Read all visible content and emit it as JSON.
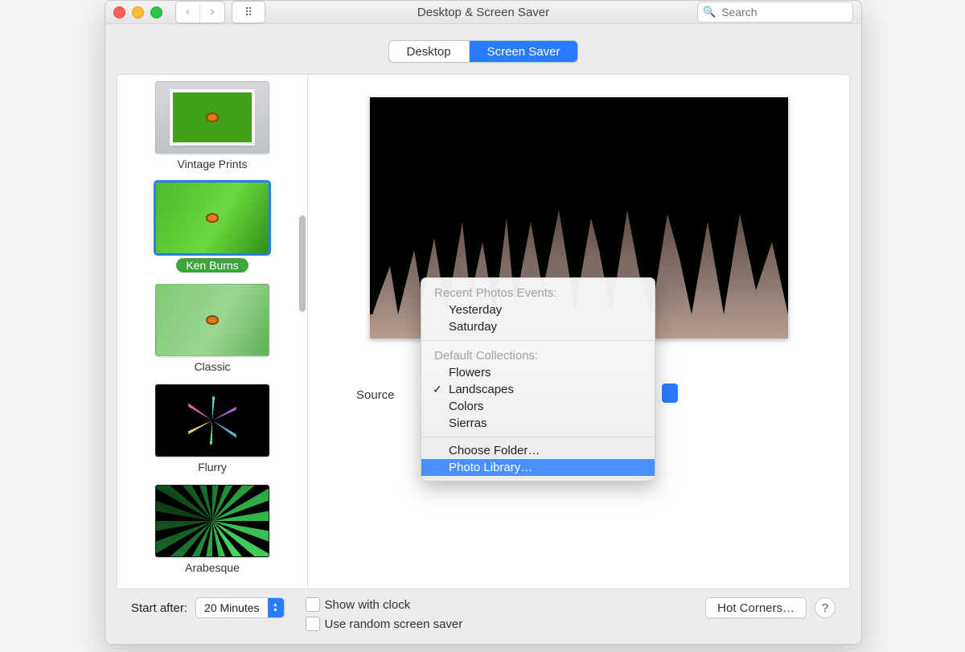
{
  "title": "Desktop & Screen Saver",
  "search": {
    "placeholder": "Search"
  },
  "segmented": {
    "desktop": "Desktop",
    "screensaver": "Screen Saver"
  },
  "savers": {
    "items": [
      {
        "label": "Vintage Prints"
      },
      {
        "label": "Ken Burns",
        "selected": true
      },
      {
        "label": "Classic"
      },
      {
        "label": "Flurry"
      },
      {
        "label": "Arabesque"
      }
    ]
  },
  "source": {
    "label": "Source"
  },
  "popup": {
    "section_recent": "Recent Photos Events:",
    "recent": [
      "Yesterday",
      "Saturday"
    ],
    "section_default": "Default Collections:",
    "defaults": [
      "Flowers",
      "Landscapes",
      "Colors",
      "Sierras"
    ],
    "checked": "Landscapes",
    "choose_folder": "Choose Folder…",
    "photo_library": "Photo Library…"
  },
  "bottom": {
    "start_after_label": "Start after:",
    "start_after_value": "20 Minutes",
    "show_with_clock": "Show with clock",
    "use_random": "Use random screen saver",
    "hot_corners": "Hot Corners…",
    "help": "?"
  }
}
